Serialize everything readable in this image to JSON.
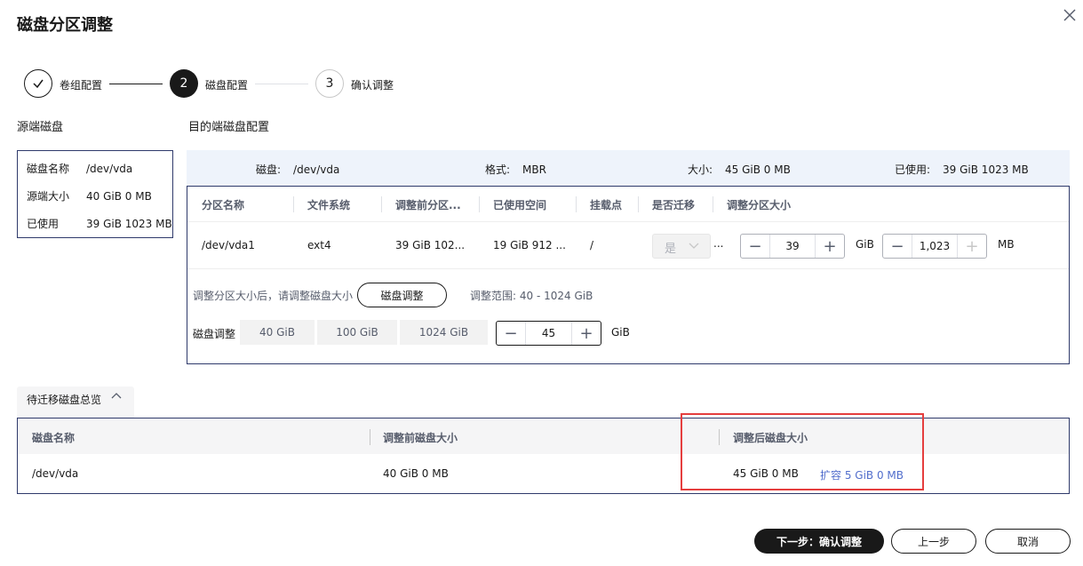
{
  "dialog": {
    "title": "磁盘分区调整",
    "close_icon": "close-icon"
  },
  "steps": [
    {
      "number": "",
      "label": "卷组配置",
      "state": "done"
    },
    {
      "number": "2",
      "label": "磁盘配置",
      "state": "active"
    },
    {
      "number": "3",
      "label": "确认调整",
      "state": "todo"
    }
  ],
  "source": {
    "heading": "源端磁盘",
    "rows": [
      {
        "key": "磁盘名称",
        "value": "/dev/vda"
      },
      {
        "key": "源端大小",
        "value": "40 GiB 0 MB"
      },
      {
        "key": "已使用",
        "value": "39 GiB 1023 MB"
      }
    ]
  },
  "target": {
    "heading": "目的端磁盘配置",
    "info": {
      "disk_label": "磁盘:",
      "disk_value": "/dev/vda",
      "format_label": "格式:",
      "format_value": "MBR",
      "size_label": "大小:",
      "size_value": "45 GiB 0 MB",
      "used_label": "已使用:",
      "used_value": "39 GiB 1023 MB"
    },
    "columns": [
      "分区名称",
      "文件系统",
      "调整前分区...",
      "已使用空间",
      "挂载点",
      "是否迁移",
      "调整分区大小"
    ],
    "row": {
      "name": "/dev/vda1",
      "fs": "ext4",
      "before": "39 GiB 102...",
      "used": "19 GiB 912 ...",
      "mount": "/",
      "migrate": "是",
      "migrate_more": "...",
      "gib_value": "39",
      "gib_unit": "GiB",
      "mb_value": "1,023",
      "mb_unit": "MB"
    },
    "hint": "调整分区大小后，请调整磁盘大小",
    "adjust_button": "磁盘调整",
    "range_text": "调整范围:  40  -  1024  GiB",
    "disk_adjust_label": "磁盘调整",
    "presets": [
      "40 GiB",
      "100 GiB",
      "1024 GiB"
    ],
    "disk_value": "45",
    "disk_unit": "GiB"
  },
  "overview": {
    "tab_label": "待迁移磁盘总览",
    "columns": [
      "磁盘名称",
      "调整前磁盘大小",
      "调整后磁盘大小"
    ],
    "row": {
      "name": "/dev/vda",
      "before": "40 GiB 0 MB",
      "after": "45 GiB 0 MB",
      "expand": "扩容 5 GiB 0 MB"
    }
  },
  "footer": {
    "next": "下一步：确认调整",
    "prev": "上一步",
    "cancel": "取消"
  },
  "colors": {
    "dark": "#191919",
    "border": "#2f3a6b",
    "link": "#526ecc",
    "highlight": "#e53e3e",
    "info_bg": "#eef3fb"
  }
}
